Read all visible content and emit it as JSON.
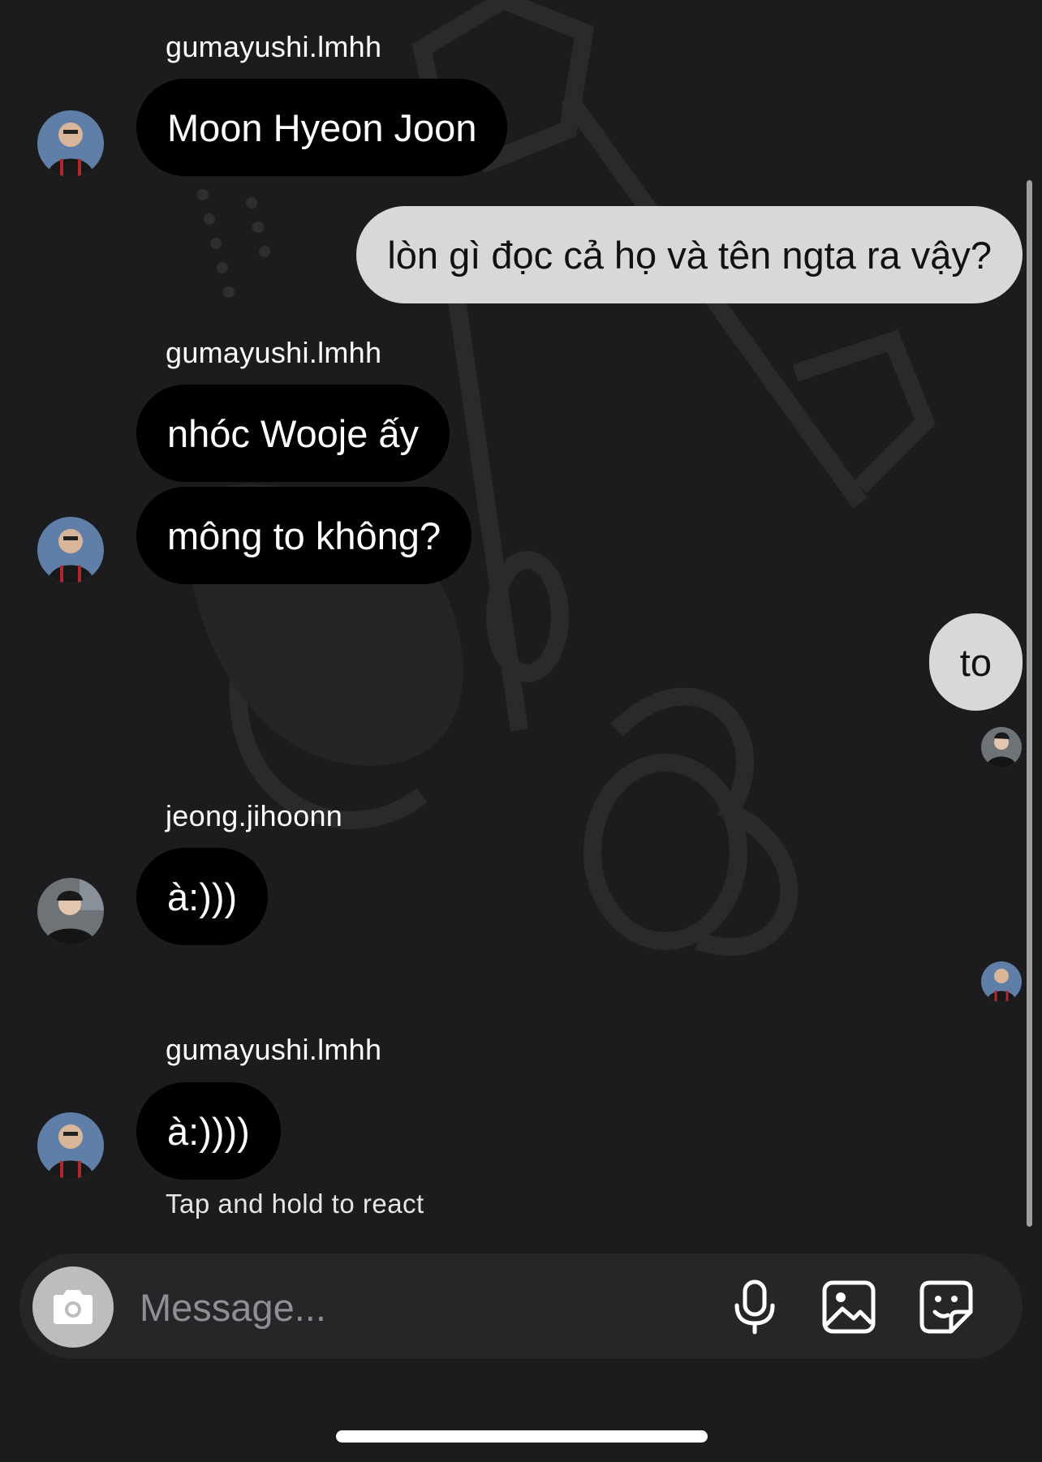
{
  "messages": [
    {
      "sender": "gumayushi.lmhh",
      "text": "Moon Hyeon Joon"
    },
    {
      "text": "lòn gì đọc cả họ và tên ngta ra vậy?"
    },
    {
      "sender": "gumayushi.lmhh",
      "text": "nhóc Wooje ấy"
    },
    {
      "text": "mông to không?"
    },
    {
      "text": "to"
    },
    {
      "sender": "jeong.jihoonn",
      "text": "à:)))"
    },
    {
      "sender": "gumayushi.lmhh",
      "text": "à:))))"
    }
  ],
  "hint": "Tap and hold to react",
  "composer": {
    "placeholder": "Message..."
  },
  "icons": {
    "camera": "camera-icon",
    "mic": "microphone-icon",
    "gallery": "image-icon",
    "sticker": "sticker-icon"
  },
  "colors": {
    "background": "#1c1c1e",
    "incoming_bubble": "#000000",
    "outgoing_bubble": "#d8d8d8",
    "composer": "#262628"
  }
}
